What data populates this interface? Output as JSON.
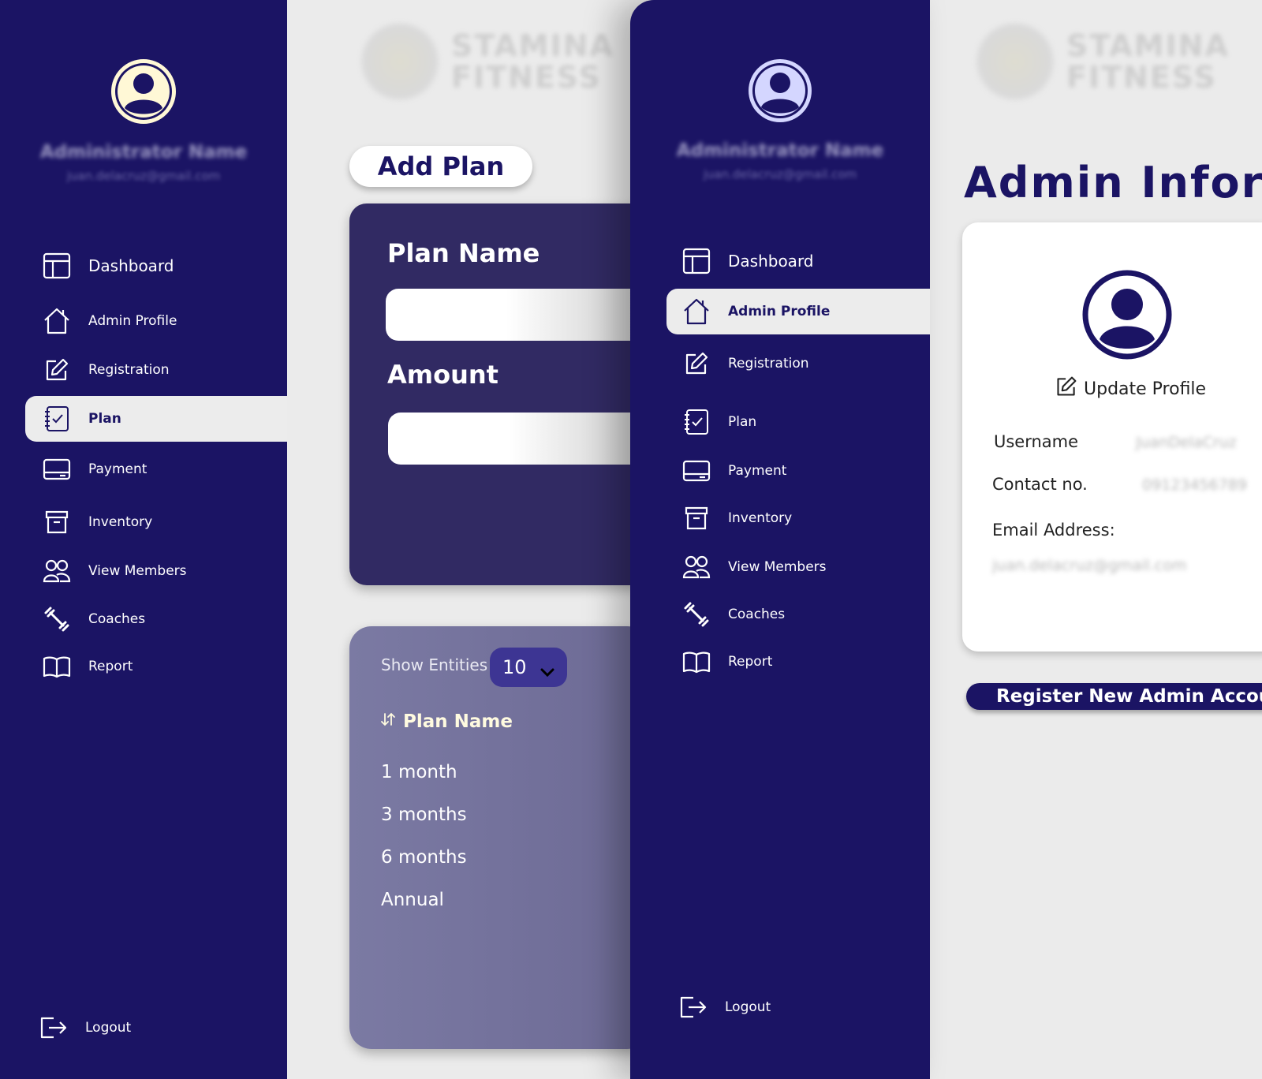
{
  "left_sidebar": {
    "admin_name": "Administrator Name",
    "admin_email": "juan.delacruz@gmail.com",
    "items": [
      {
        "label": "Dashboard",
        "icon": "dashboard-icon"
      },
      {
        "label": "Admin Profile",
        "icon": "home-icon"
      },
      {
        "label": "Registration",
        "icon": "edit-icon"
      },
      {
        "label": "Plan",
        "icon": "checklist-icon",
        "active": true
      },
      {
        "label": "Payment",
        "icon": "card-icon"
      },
      {
        "label": "Inventory",
        "icon": "archive-icon"
      },
      {
        "label": "View Members",
        "icon": "members-icon"
      },
      {
        "label": "Coaches",
        "icon": "dumbbell-icon"
      },
      {
        "label": "Report",
        "icon": "book-icon"
      }
    ],
    "logout_label": "Logout"
  },
  "logo": {
    "line1": "STAMINA",
    "line2": "FITNESS"
  },
  "plan_page": {
    "add_plan_label": "Add Plan",
    "plan_name_label": "Plan Name",
    "amount_label": "Amount",
    "plan_name_value": "",
    "amount_value": "",
    "show_entities_label": "Show Entities",
    "entities_value": "10",
    "column_header": "Plan Name",
    "rows": [
      "1 month",
      "3 months",
      "6 months",
      "Annual"
    ]
  },
  "right_sidebar": {
    "admin_name": "Administrator Name",
    "admin_email": "juan.delacruz@gmail.com",
    "items": [
      {
        "label": "Dashboard",
        "icon": "dashboard-icon"
      },
      {
        "label": "Admin Profile",
        "icon": "home-icon",
        "active": true
      },
      {
        "label": "Registration",
        "icon": "edit-icon"
      },
      {
        "label": "Plan",
        "icon": "checklist-icon"
      },
      {
        "label": "Payment",
        "icon": "card-icon"
      },
      {
        "label": "Inventory",
        "icon": "archive-icon"
      },
      {
        "label": "View Members",
        "icon": "members-icon"
      },
      {
        "label": "Coaches",
        "icon": "dumbbell-icon"
      },
      {
        "label": "Report",
        "icon": "book-icon"
      }
    ],
    "logout_label": "Logout"
  },
  "admin_page": {
    "title": "Admin Inform",
    "update_profile_label": "Update Profile",
    "username_label": "Username",
    "username_value": "JuanDelaCruz",
    "contact_label": "Contact no.",
    "contact_value": "09123456789",
    "email_label": "Email Address:",
    "email_value": "juan.delacruz@gmail.com",
    "register_label": "Register New Admin Account"
  },
  "colors": {
    "sidebar_bg": "#1b1464",
    "plan_card_bg": "#312a63",
    "entities_card_bg": "#7b7aa3",
    "page_bg": "#ebebeb",
    "avatar_left": "#fff8d6",
    "avatar_right": "#d4d6ff"
  }
}
